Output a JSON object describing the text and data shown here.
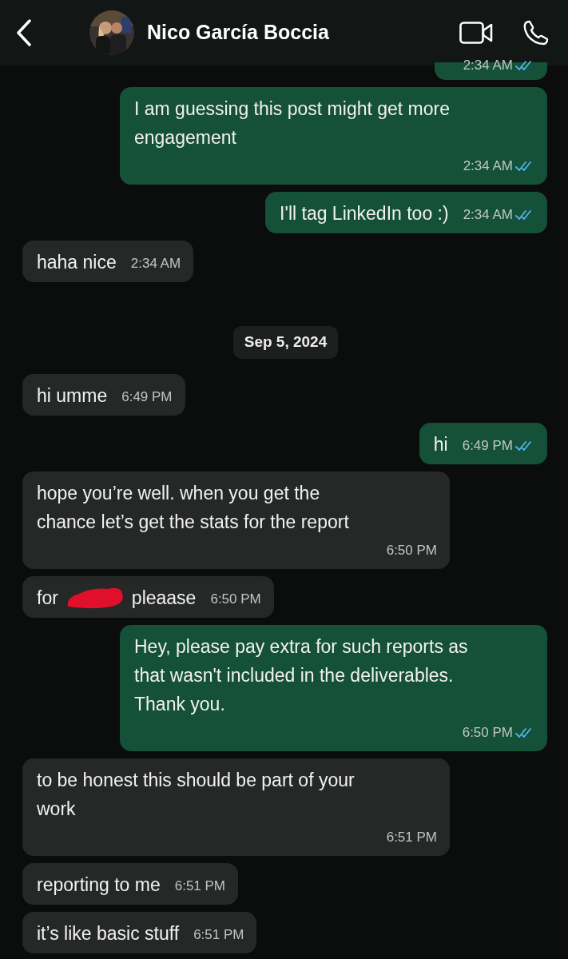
{
  "header": {
    "contact_name": "Nico García Boccia"
  },
  "messages": [
    {
      "kind": "outgoing",
      "time": "2:34 AM",
      "read": true
    },
    {
      "kind": "outgoing",
      "text": "I am guessing this post might get more engagement",
      "time": "2:34 AM",
      "read": true
    },
    {
      "kind": "outgoing",
      "text": "I'll tag LinkedIn too :)",
      "time": "2:34 AM",
      "read": true
    },
    {
      "kind": "incoming",
      "text": "haha nice",
      "time": "2:34 AM"
    },
    {
      "kind": "date",
      "text": "Sep 5, 2024"
    },
    {
      "kind": "incoming",
      "text": "hi umme",
      "time": "6:49 PM"
    },
    {
      "kind": "outgoing",
      "text": "hi",
      "time": "6:49 PM",
      "read": true
    },
    {
      "kind": "incoming",
      "text": "hope you’re well. when you get the chance let’s get the stats for the report",
      "time": "6:50 PM"
    },
    {
      "kind": "incoming",
      "text": "for",
      "redacted": true,
      "text_after": "pleaase",
      "time": "6:50 PM"
    },
    {
      "kind": "outgoing",
      "text": "Hey, please pay extra for such reports as that wasn't included in the deliverables. Thank you.",
      "time": "6:50 PM",
      "read": true
    },
    {
      "kind": "incoming",
      "text": "to be honest this should be part of your work",
      "time": "6:51 PM"
    },
    {
      "kind": "incoming",
      "text": "reporting to me",
      "time": "6:51 PM"
    },
    {
      "kind": "incoming",
      "text": "it’s like basic stuff",
      "time": "6:51 PM"
    }
  ]
}
